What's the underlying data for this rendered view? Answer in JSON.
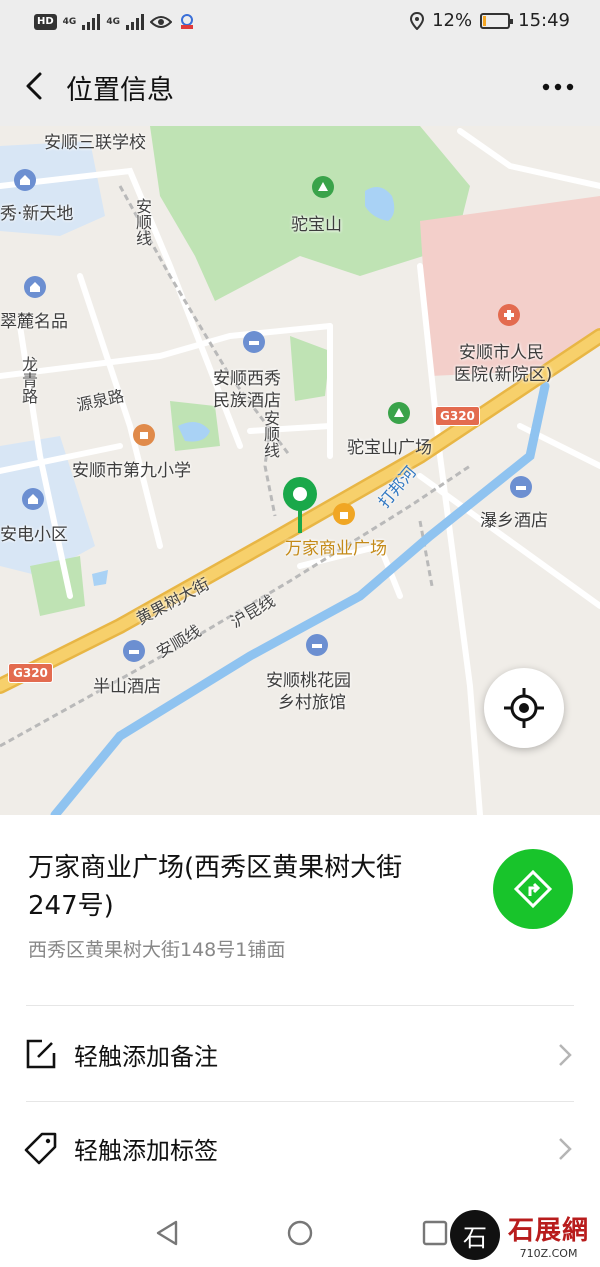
{
  "status_bar": {
    "hd": "HD",
    "net1": "4G",
    "net2": "4G",
    "battery_text": "12%",
    "battery_level": 0.12,
    "time": "15:49"
  },
  "nav": {
    "title": "位置信息",
    "back_icon": "chevron-left-icon",
    "more_icon": "more-dots-icon"
  },
  "map": {
    "labels": {
      "school_top": "安顺三联学校",
      "xiu_xintiandi": "秀·新天地",
      "tuobao_shan": "驼宝山",
      "anshun_line": "安顺线",
      "cuilu": "翠麓名品",
      "longqing_lu": "龙青路",
      "yuanquan_lu": "源泉路",
      "hotel_xixiu_1": "安顺西秀",
      "hotel_xixiu_2": "民族酒店",
      "anshun_line_2": "安顺线",
      "hospital_1": "安顺市人民",
      "hospital_2": "医院(新院区)",
      "g320_east": "G320",
      "tuobaoshan_square": "驼宝山广场",
      "school_ninth": "安顺市第九小学",
      "dabang_river": "打邦河",
      "pu_xiang_hotel": "瀑乡酒店",
      "dian_xiaoqu": "安电小区",
      "wanjia_store": "万家商业广场",
      "huangguoshu_street": "黄果树大街",
      "hukun_line": "沪昆线",
      "anshun_line_3": "安顺线",
      "g320_west": "G320",
      "banshan_hotel": "半山酒店",
      "taohuayuan_1": "安顺桃花园",
      "taohuayuan_2": "乡村旅馆"
    },
    "locate_icon": "crosshair-locate-icon",
    "pin_icon": "location-pin-icon"
  },
  "place": {
    "name": "万家商业广场(西秀区黄果树大街247号)",
    "address": "西秀区黄果树大街148号1铺面",
    "navigate_icon": "navigation-arrow-icon"
  },
  "actions": {
    "add_note": "轻触添加备注",
    "add_tag": "轻触添加标签"
  },
  "watermark": {
    "seal": "石",
    "name": "石展網",
    "domain": "710Z.COM"
  },
  "colors": {
    "green": "#18c42b",
    "pin_green": "#1aa84a",
    "road_yellow": "#f5c553",
    "river_blue": "#8fc3f0",
    "park_green": "#bfe3b4",
    "hospital_red": "#f3cfca"
  }
}
